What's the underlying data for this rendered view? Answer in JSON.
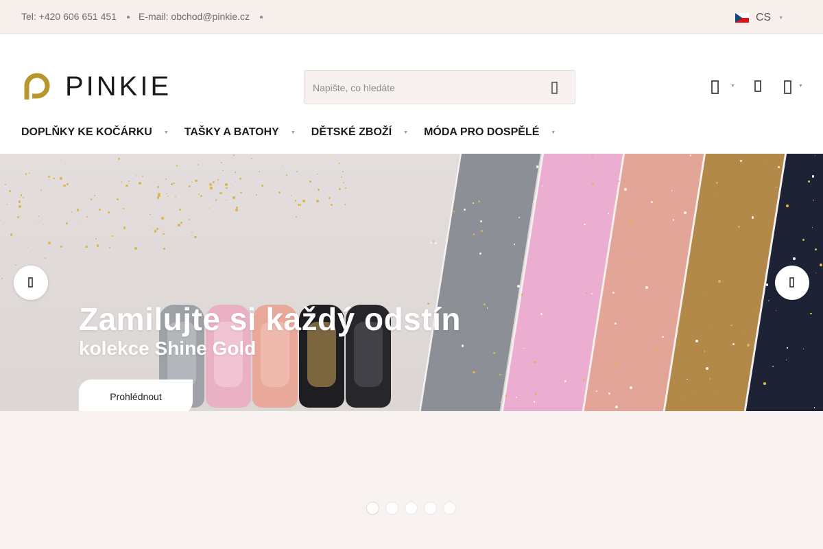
{
  "topbar": {
    "phone": "Tel: +420 606 651 451",
    "email": "E-mail: obchod@pinkie.cz",
    "language": "CS",
    "flag_icon": "czech-flag-icon"
  },
  "header": {
    "logo_text": "PINKIE",
    "search_placeholder": "Napište, co hledáte",
    "icons": [
      "user-icon",
      "heart-icon",
      "cart-icon"
    ]
  },
  "nav": {
    "items": [
      {
        "label": "DOPLŇKY KE KOČÁRKU"
      },
      {
        "label": "TAŠKY A BATOHY"
      },
      {
        "label": "DĚTSKÉ ZBOŽÍ"
      },
      {
        "label": "MÓDA PRO DOSPĚLÉ"
      }
    ]
  },
  "hero": {
    "title": "Zamilujte si každý odstín",
    "subtitle": "kolekce Shine Gold",
    "button": "Prohlédnout",
    "slides_count": 5,
    "active_slide": 1
  },
  "colors": {
    "brand_gold": "#b8962e",
    "topbar_bg": "#f6efec",
    "page_bg": "#f8f2f0",
    "stripes": [
      "#8d8f97",
      "#ecaed0",
      "#e3a598",
      "#b3894a",
      "#1d2334"
    ]
  }
}
